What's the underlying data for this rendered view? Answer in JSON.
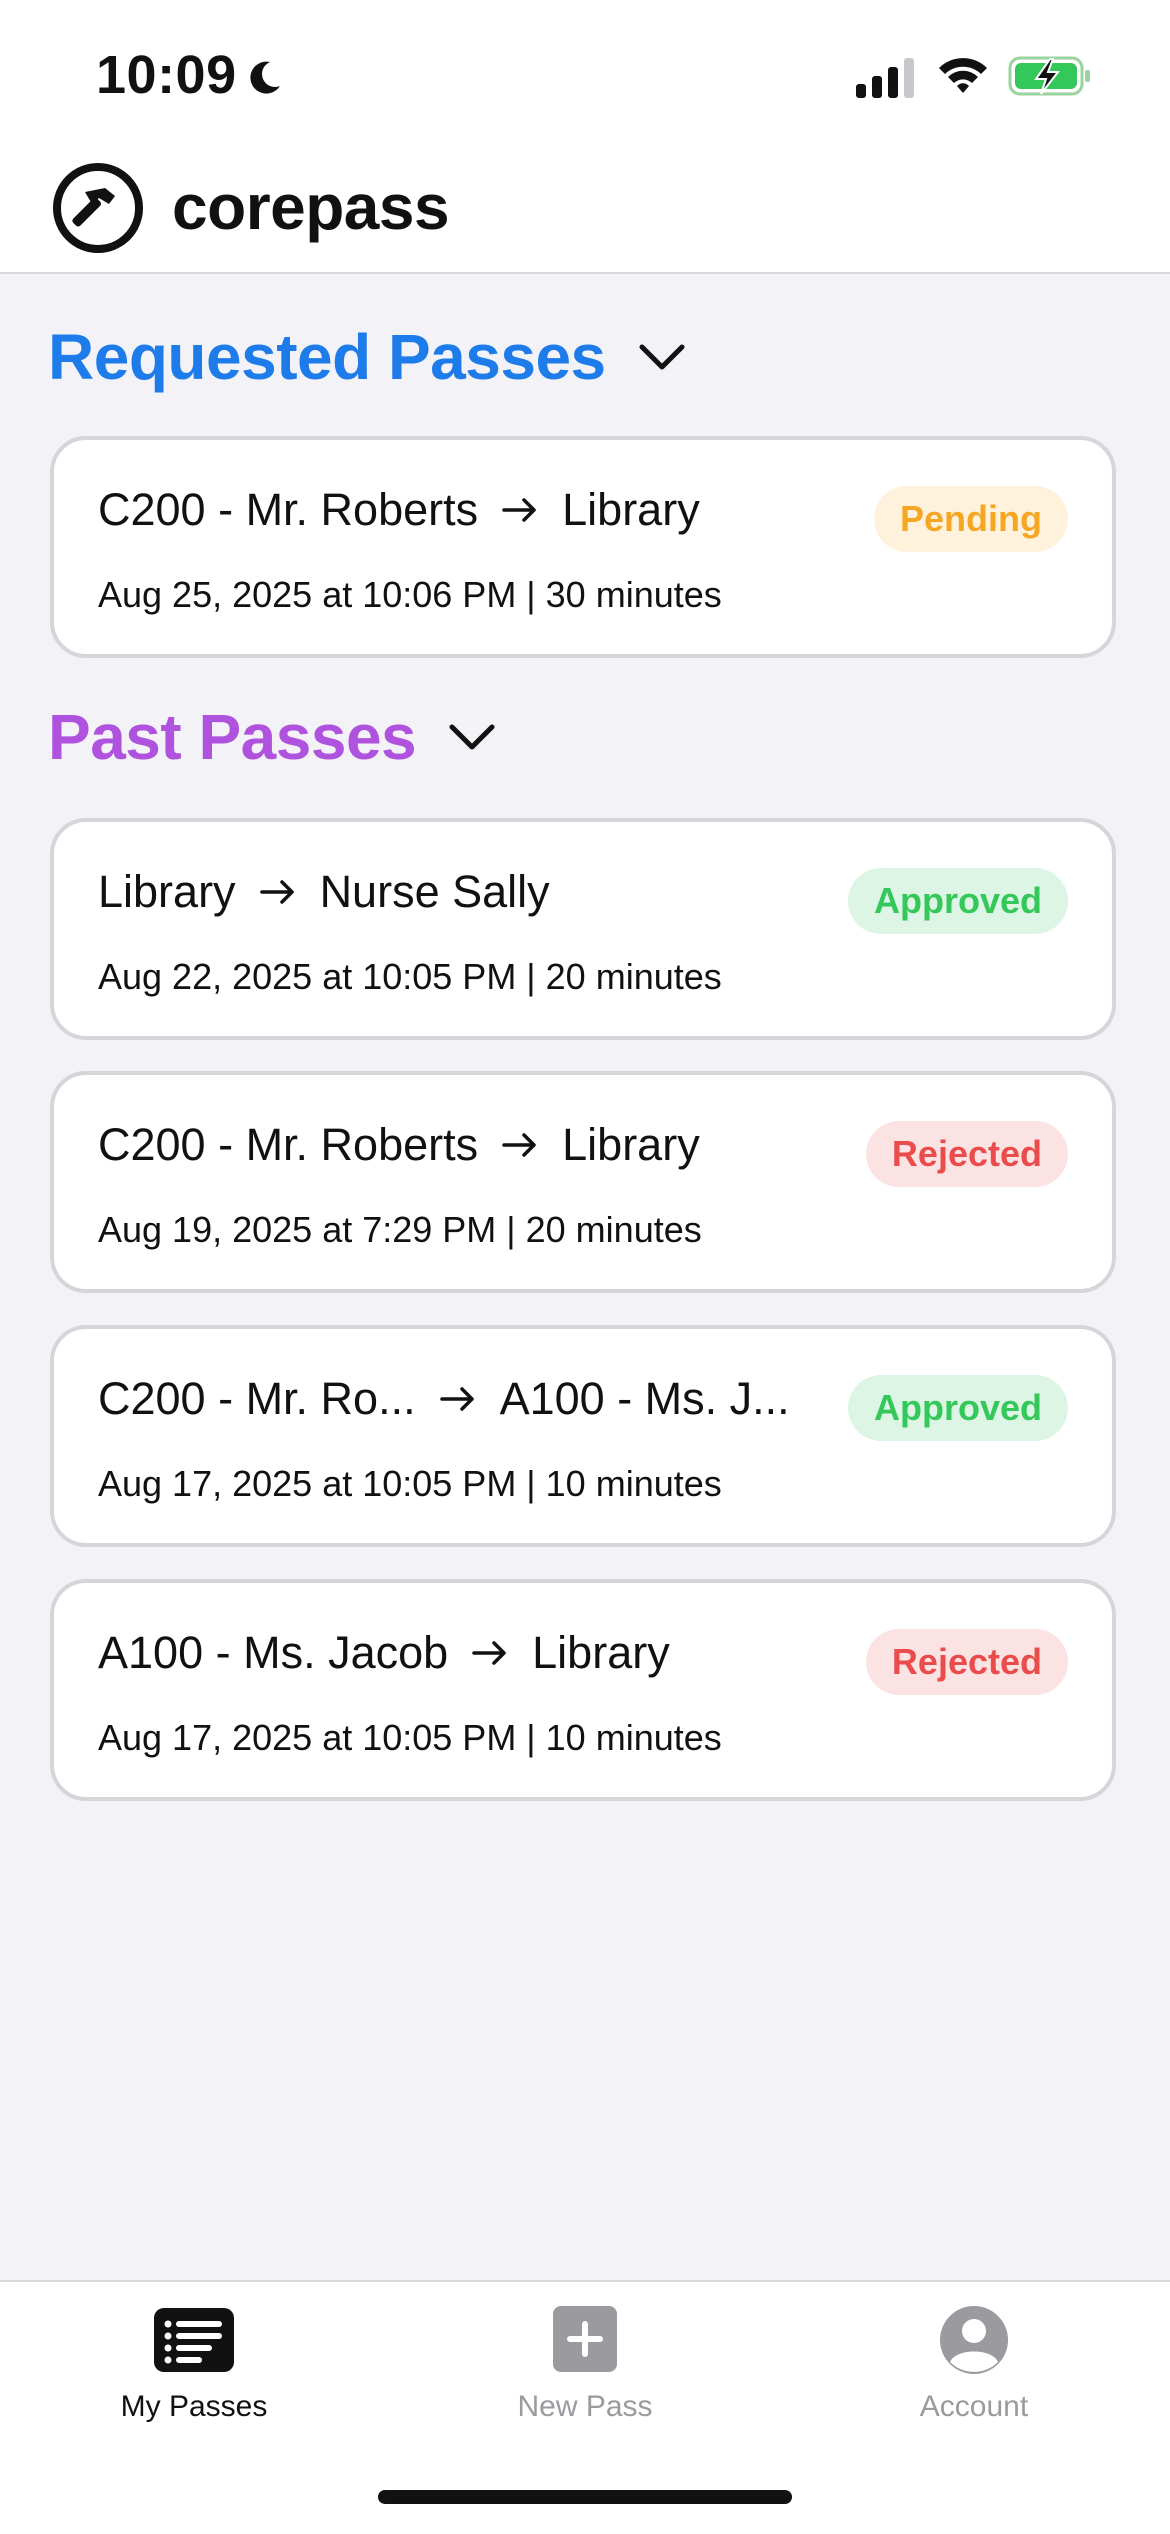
{
  "status_bar": {
    "time": "10:09"
  },
  "app": {
    "title": "corepass"
  },
  "requested": {
    "title": "Requested Passes",
    "color": "#1E7BEA",
    "passes": [
      {
        "from": "C200 - Mr. Roberts",
        "to": "Library",
        "meta": "Aug 25, 2025 at 10:06 PM | 30 minutes",
        "status": "Pending"
      }
    ]
  },
  "past": {
    "title": "Past Passes",
    "color": "#AF52DE",
    "passes": [
      {
        "from": "Library",
        "to": "Nurse Sally",
        "meta": "Aug 22, 2025 at 10:05 PM | 20 minutes",
        "status": "Approved"
      },
      {
        "from": "C200 - Mr. Roberts",
        "to": "Library",
        "meta": "Aug 19, 2025 at 7:29 PM | 20 minutes",
        "status": "Rejected"
      },
      {
        "from": "C200 - Mr. Ro...",
        "to": "A100 - Ms. J...",
        "meta": "Aug 17, 2025 at 10:05 PM | 10 minutes",
        "status": "Approved"
      },
      {
        "from": "A100 - Ms. Jacob",
        "to": "Library",
        "meta": "Aug 17, 2025 at 10:05 PM | 10 minutes",
        "status": "Rejected"
      }
    ]
  },
  "tabs": [
    {
      "label": "My Passes",
      "icon": "list-icon",
      "active": true
    },
    {
      "label": "New Pass",
      "icon": "plus-square-icon",
      "active": false
    },
    {
      "label": "Account",
      "icon": "person-circle-icon",
      "active": false
    }
  ],
  "colors": {
    "pending": "#F5A623",
    "approved": "#34C759",
    "rejected": "#EA4B4B",
    "tab_active": "#111111",
    "tab_inactive": "#9A9A9F"
  }
}
